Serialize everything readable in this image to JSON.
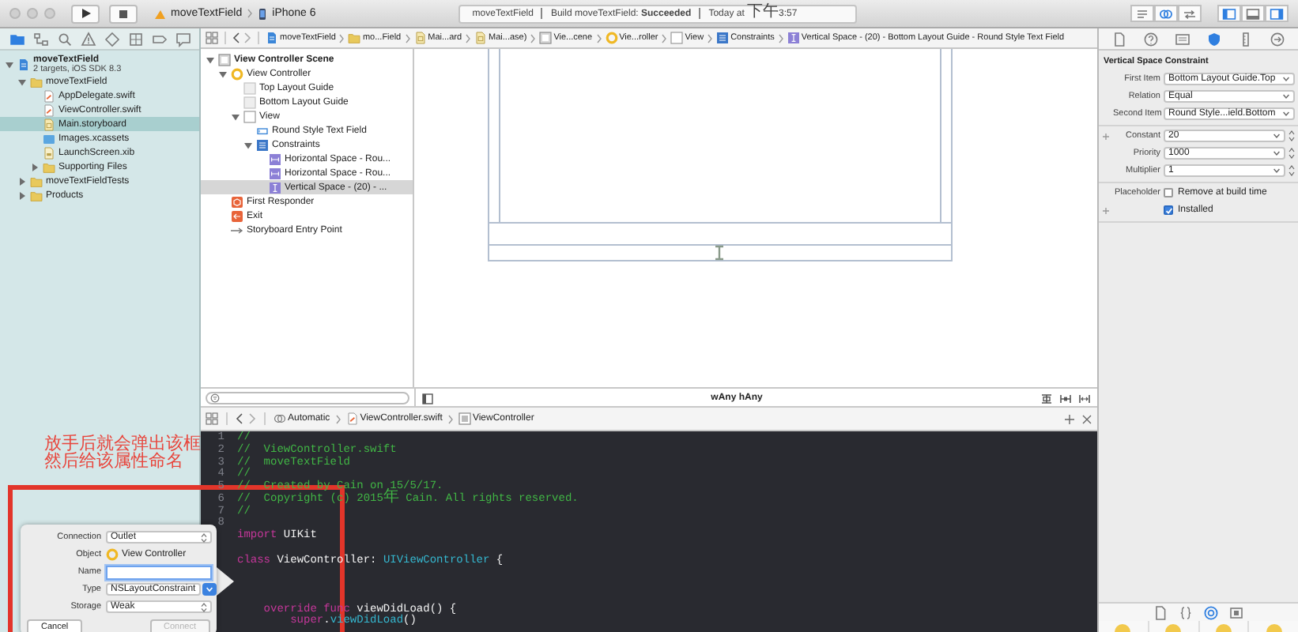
{
  "toolbar": {
    "scheme": {
      "target": "moveTextField",
      "device": "iPhone 6"
    },
    "status": {
      "project": "moveTextField",
      "build": "Build moveTextField: **Succeeded**",
      "time": "Today at 下午3:57"
    },
    "editor_modes": [
      {
        "kind": "standard",
        "selected": false
      },
      {
        "kind": "assistant",
        "selected": true
      },
      {
        "kind": "version",
        "selected": false
      }
    ],
    "panel_toggles": [
      {
        "kind": "navigator",
        "on": true
      },
      {
        "kind": "debug",
        "on": false
      },
      {
        "kind": "utilities",
        "on": true
      }
    ]
  },
  "navigator": {
    "tabs": [
      {
        "kind": "folder",
        "selected": true
      },
      {
        "kind": "hierarchy",
        "selected": false
      },
      {
        "kind": "search",
        "selected": false
      },
      {
        "kind": "warning",
        "selected": false
      },
      {
        "kind": "test",
        "selected": false
      },
      {
        "kind": "debug",
        "selected": false
      },
      {
        "kind": "breakpoint",
        "selected": false
      },
      {
        "kind": "log",
        "selected": false
      }
    ],
    "tree": [
      {
        "kind": "project",
        "label": "moveTextField",
        "subtitle": "2 targets, iOS SDK 8.3",
        "expanded": true,
        "selected": false,
        "children": [
          {
            "kind": "folder",
            "label": "moveTextField",
            "expanded": true,
            "selected": false,
            "children": [
              {
                "kind": "swift",
                "label": "AppDelegate.swift",
                "selected": false
              },
              {
                "kind": "swift",
                "label": "ViewController.swift",
                "selected": false
              },
              {
                "kind": "storyboard",
                "label": "Main.storyboard",
                "selected": true
              },
              {
                "kind": "xcassets",
                "label": "Images.xcassets",
                "selected": false
              },
              {
                "kind": "xib",
                "label": "LaunchScreen.xib",
                "selected": false
              },
              {
                "kind": "folder",
                "label": "Supporting Files",
                "expanded": false,
                "selected": false
              }
            ]
          },
          {
            "kind": "folder",
            "label": "moveTextFieldTests",
            "expanded": false,
            "selected": false
          },
          {
            "kind": "folder",
            "label": "Products",
            "expanded": false,
            "selected": false
          }
        ]
      }
    ]
  },
  "jump_bar": [
    {
      "kind": "project",
      "label": "moveTextField"
    },
    {
      "kind": "folder",
      "label": "mo...Field"
    },
    {
      "kind": "storyboard",
      "label": "Mai...ard"
    },
    {
      "kind": "storyboard",
      "label": "Mai...ase)"
    },
    {
      "kind": "scene",
      "label": "Vie...cene"
    },
    {
      "kind": "controller",
      "label": "Vie...roller"
    },
    {
      "kind": "view",
      "label": "View"
    },
    {
      "kind": "constraints",
      "label": "Constraints"
    },
    {
      "kind": "constraint_v",
      "label": "Vertical Space - (20) - Bottom Layout Guide - Round Style Text Field"
    }
  ],
  "outline": {
    "tree": [
      {
        "kind": "scene",
        "label": "View Controller Scene",
        "expanded": true,
        "selected": false,
        "children": [
          {
            "kind": "controller",
            "label": "View Controller",
            "expanded": true,
            "selected": false,
            "children": [
              {
                "kind": "guide",
                "label": "Top Layout Guide",
                "selected": false
              },
              {
                "kind": "guide",
                "label": "Bottom Layout Guide",
                "selected": false
              },
              {
                "kind": "view",
                "label": "View",
                "expanded": true,
                "selected": false,
                "children": [
                  {
                    "kind": "textfield",
                    "label": "Round Style Text Field",
                    "selected": false
                  },
                  {
                    "kind": "constraints",
                    "label": "Constraints",
                    "expanded": true,
                    "selected": false,
                    "children": [
                      {
                        "kind": "constraint_h",
                        "label": "Horizontal Space - Rou...",
                        "selected": false
                      },
                      {
                        "kind": "constraint_h",
                        "label": "Horizontal Space - Rou...",
                        "selected": false
                      },
                      {
                        "kind": "constraint_v",
                        "label": "Vertical Space - (20) - ...",
                        "selected": true
                      }
                    ]
                  }
                ]
              }
            ]
          },
          {
            "kind": "responder",
            "label": "First Responder",
            "selected": false
          },
          {
            "kind": "exit",
            "label": "Exit",
            "selected": false
          },
          {
            "kind": "entry",
            "label": "Storyboard Entry Point",
            "selected": false
          }
        ]
      }
    ]
  },
  "canvas_bar": {
    "size_class": "wAny hAny"
  },
  "assistant_bar": [
    {
      "kind": "automatic",
      "label": "Automatic"
    },
    {
      "kind": "swift",
      "label": "ViewController.swift"
    },
    {
      "kind": "class",
      "label": "ViewController"
    }
  ],
  "code": {
    "lines": [
      {
        "kind": "code",
        "number": "1",
        "tokens": [
          {
            "kind": "comment",
            "text": "//"
          }
        ]
      },
      {
        "kind": "code",
        "number": "2",
        "tokens": [
          {
            "kind": "comment",
            "text": "//  ViewController.swift"
          }
        ]
      },
      {
        "kind": "code",
        "number": "3",
        "tokens": [
          {
            "kind": "comment",
            "text": "//  moveTextField"
          }
        ]
      },
      {
        "kind": "code",
        "number": "4",
        "tokens": [
          {
            "kind": "comment",
            "text": "//"
          }
        ]
      },
      {
        "kind": "code",
        "number": "5",
        "tokens": [
          {
            "kind": "comment",
            "text": "//  Created by Cain on 15/5/17."
          }
        ]
      },
      {
        "kind": "code",
        "number": "6",
        "tokens": [
          {
            "kind": "comment",
            "text": "//  Copyright (c) 2015年 Cain. All rights reserved."
          }
        ]
      },
      {
        "kind": "code",
        "number": "7",
        "tokens": [
          {
            "kind": "comment",
            "text": "//"
          }
        ]
      },
      {
        "kind": "blank",
        "number": "8"
      },
      {
        "kind": "code",
        "tokens": [
          {
            "kind": "keyword",
            "text": "import"
          },
          {
            "kind": "plain",
            "text": " UIKit"
          }
        ]
      },
      {
        "kind": "blank"
      },
      {
        "kind": "code",
        "tokens": [
          {
            "kind": "keyword",
            "text": "class"
          },
          {
            "kind": "plain",
            "text": " ViewController: "
          },
          {
            "kind": "type",
            "text": "UIViewController"
          },
          {
            "kind": "plain",
            "text": " {"
          }
        ]
      },
      {
        "kind": "blank"
      },
      {
        "kind": "blank"
      },
      {
        "kind": "blank"
      },
      {
        "kind": "code",
        "tokens": [
          {
            "kind": "keyword",
            "text": "    override func"
          },
          {
            "kind": "plain",
            "text": " viewDidLoad() {"
          }
        ]
      },
      {
        "kind": "code",
        "tokens": [
          {
            "kind": "keyword",
            "text": "        super"
          },
          {
            "kind": "plain",
            "text": "."
          },
          {
            "kind": "type",
            "text": "viewDidLoad"
          },
          {
            "kind": "plain",
            "text": "()"
          }
        ]
      }
    ]
  },
  "inspector": {
    "tabs": [
      {
        "kind": "file",
        "selected": false
      },
      {
        "kind": "help",
        "selected": false
      },
      {
        "kind": "identity",
        "selected": false
      },
      {
        "kind": "attributes",
        "selected": true
      },
      {
        "kind": "size",
        "selected": false
      },
      {
        "kind": "connections",
        "selected": false
      }
    ],
    "title": "Vertical Space Constraint",
    "sections": [
      {
        "fields": [
          {
            "kind": "popup",
            "label": "First Item",
            "value": "Bottom Layout Guide.Top",
            "has_variations": false
          },
          {
            "kind": "popup",
            "label": "Relation",
            "value": "Equal",
            "has_variations": false
          },
          {
            "kind": "popup",
            "label": "Second Item",
            "value": "Round Style...ield.Bottom",
            "has_variations": false
          }
        ]
      },
      {
        "fields": [
          {
            "kind": "stepper",
            "label": "Constant",
            "value": "20",
            "has_variations": true
          },
          {
            "kind": "stepper",
            "label": "Priority",
            "value": "1000",
            "has_variations": false
          },
          {
            "kind": "stepper",
            "label": "Multiplier",
            "value": "1",
            "has_variations": false
          }
        ]
      },
      {
        "fields": [
          {
            "kind": "checkbox",
            "label": "Placeholder",
            "text": "Remove at build time",
            "checked": false,
            "has_variations": false
          },
          {
            "kind": "checkbox",
            "text": "Installed",
            "checked": true,
            "has_variations": true
          }
        ]
      }
    ],
    "library_tabs": [
      {
        "kind": "file",
        "selected": false
      },
      {
        "kind": "braces",
        "selected": false
      },
      {
        "kind": "object",
        "selected": true
      },
      {
        "kind": "media",
        "selected": false
      }
    ]
  },
  "annotation": {
    "lines": [
      "放手后就会弹出该框",
      "然后给该属性命名"
    ]
  },
  "connection_popup": {
    "fields": [
      {
        "kind": "popup",
        "label": "Connection",
        "value": "Outlet"
      },
      {
        "kind": "object",
        "label": "Object",
        "value": "View Controller"
      },
      {
        "kind": "input",
        "label": "Name",
        "focused": true
      },
      {
        "kind": "type",
        "label": "Type",
        "value": "NSLayoutConstraint"
      },
      {
        "kind": "popup",
        "label": "Storage",
        "value": "Weak"
      }
    ],
    "buttons": [
      {
        "label": "Cancel",
        "disabled": false
      },
      {
        "label": "Connect",
        "disabled": true
      }
    ]
  }
}
